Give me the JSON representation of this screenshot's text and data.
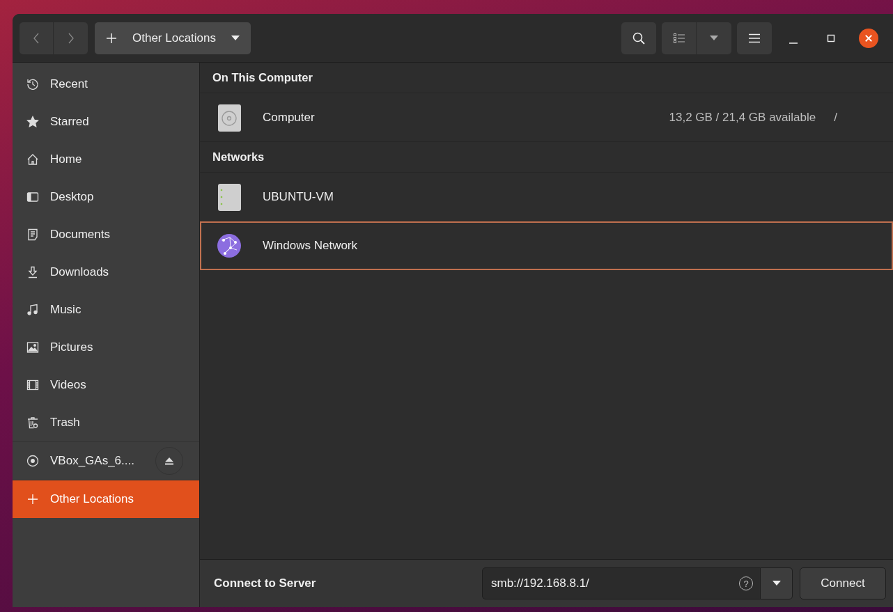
{
  "header": {
    "location": "Other Locations"
  },
  "sidebar": {
    "items": [
      {
        "label": "Recent",
        "kind": "place",
        "selected": false
      },
      {
        "label": "Starred",
        "kind": "place",
        "selected": false
      },
      {
        "label": "Home",
        "kind": "place",
        "selected": false
      },
      {
        "label": "Desktop",
        "kind": "place",
        "selected": false
      },
      {
        "label": "Documents",
        "kind": "place",
        "selected": false
      },
      {
        "label": "Downloads",
        "kind": "place",
        "selected": false
      },
      {
        "label": "Music",
        "kind": "place",
        "selected": false
      },
      {
        "label": "Pictures",
        "kind": "place",
        "selected": false
      },
      {
        "label": "Videos",
        "kind": "place",
        "selected": false
      },
      {
        "label": "Trash",
        "kind": "place",
        "selected": false
      },
      {
        "label": "VBox_GAs_6....",
        "kind": "mount",
        "selected": false
      },
      {
        "label": "Other Locations",
        "kind": "other",
        "selected": true
      }
    ]
  },
  "sections": [
    {
      "title": "On This Computer",
      "rows": [
        {
          "name": "Computer",
          "info": "13,2 GB / 21,4 GB available",
          "path": "/",
          "selected": false
        }
      ]
    },
    {
      "title": "Networks",
      "rows": [
        {
          "name": "UBUNTU-VM",
          "selected": false
        },
        {
          "name": "Windows Network",
          "selected": true
        }
      ]
    }
  ],
  "connect": {
    "label": "Connect to Server",
    "value": "smb://192.168.8.1/",
    "help": "?",
    "button": "Connect"
  }
}
